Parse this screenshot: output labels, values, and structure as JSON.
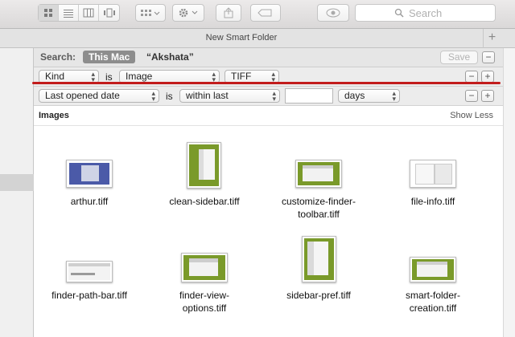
{
  "toolbar": {
    "search_placeholder": "Search"
  },
  "tab": {
    "title": "New Smart Folder",
    "add_label": "+"
  },
  "searchbar": {
    "label": "Search:",
    "scope_active": "This Mac",
    "scope_other": "“Akshata”",
    "save_label": "Save",
    "remove_label": "−"
  },
  "criteria": [
    {
      "attribute": "Kind",
      "operator": "is",
      "value": "Image",
      "subvalue": "TIFF"
    },
    {
      "attribute": "Last opened date",
      "operator": "is",
      "value": "within last",
      "amount": "",
      "unit": "days"
    }
  ],
  "buttons": {
    "minus": "−",
    "plus": "+"
  },
  "group": {
    "title": "Images",
    "toggle": "Show Less"
  },
  "files": [
    {
      "line1": "arthur.tiff",
      "line2": ""
    },
    {
      "line1": "clean-sidebar.tiff",
      "line2": ""
    },
    {
      "line1": "customize-finder-",
      "line2": "toolbar.tiff"
    },
    {
      "line1": "file-info.tiff",
      "line2": ""
    },
    {
      "line1": "finder-path-bar.tiff",
      "line2": ""
    },
    {
      "line1": "finder-view-",
      "line2": "options.tiff"
    },
    {
      "line1": "sidebar-pref.tiff",
      "line2": ""
    },
    {
      "line1": "smart-folder-",
      "line2": "creation.tiff"
    }
  ],
  "colors": {
    "annotation_line": "#c21c1c",
    "scope_active_bg": "#8d8d8d",
    "thumb_green": "#7a9a2a"
  }
}
